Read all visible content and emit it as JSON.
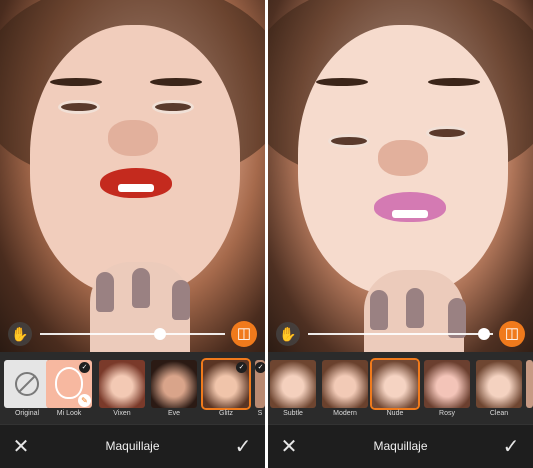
{
  "left_panel": {
    "looks": [
      {
        "label": "Original",
        "selected": false,
        "applied": false
      },
      {
        "label": "Mi Look",
        "selected": false,
        "applied": true
      },
      {
        "label": "Vixen",
        "selected": false,
        "applied": false
      },
      {
        "label": "Eve",
        "selected": false,
        "applied": false
      },
      {
        "label": "Glitz",
        "selected": true,
        "applied": true
      },
      {
        "label": "S",
        "selected": false,
        "applied": true
      }
    ],
    "intensity": 0.65,
    "bar_title": "Maquillaje"
  },
  "right_panel": {
    "looks": [
      {
        "label": "Subtle",
        "selected": false
      },
      {
        "label": "Modern",
        "selected": false
      },
      {
        "label": "Nude",
        "selected": true
      },
      {
        "label": "Rosy",
        "selected": false
      },
      {
        "label": "Clean",
        "selected": false
      }
    ],
    "intensity": 0.95,
    "bar_title": "Maquillaje"
  },
  "icons": {
    "hand": "hand-touch-icon",
    "compare": "split-compare-icon",
    "close": "close-icon",
    "confirm": "checkmark-icon",
    "none": "no-effect-icon",
    "edit": "pencil-icon",
    "applied": "check-badge-icon"
  },
  "colors": {
    "accent": "#f07a1c",
    "bar_bg": "#1e1e1e",
    "strip_bg": "#2b2b2b",
    "lips_red": "#c42a1e",
    "lips_pink": "#d47ab3"
  }
}
